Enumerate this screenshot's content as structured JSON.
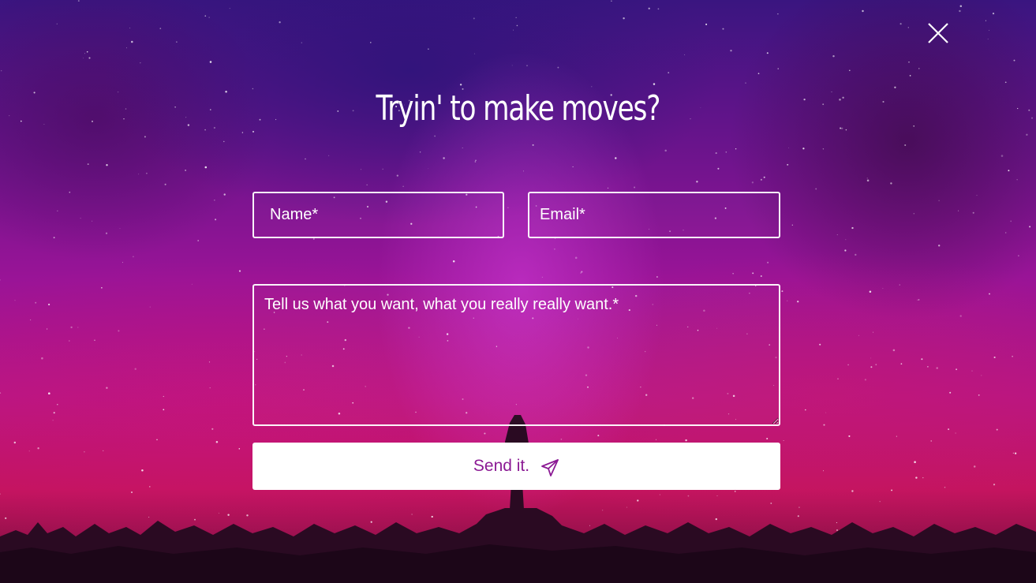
{
  "modal": {
    "headline": "Tryin' to make moves?",
    "close_icon": "close-icon"
  },
  "form": {
    "name_placeholder": "Name*",
    "email_placeholder": "Email*",
    "message_placeholder": "Tell us what you want, what you really really want.*",
    "name_value": "",
    "email_value": "",
    "message_value": "",
    "submit_label": "Send it.",
    "submit_icon": "paper-plane-icon"
  },
  "colors": {
    "accent": "#8b1a94",
    "text": "#ffffff",
    "button_bg": "#ffffff"
  }
}
